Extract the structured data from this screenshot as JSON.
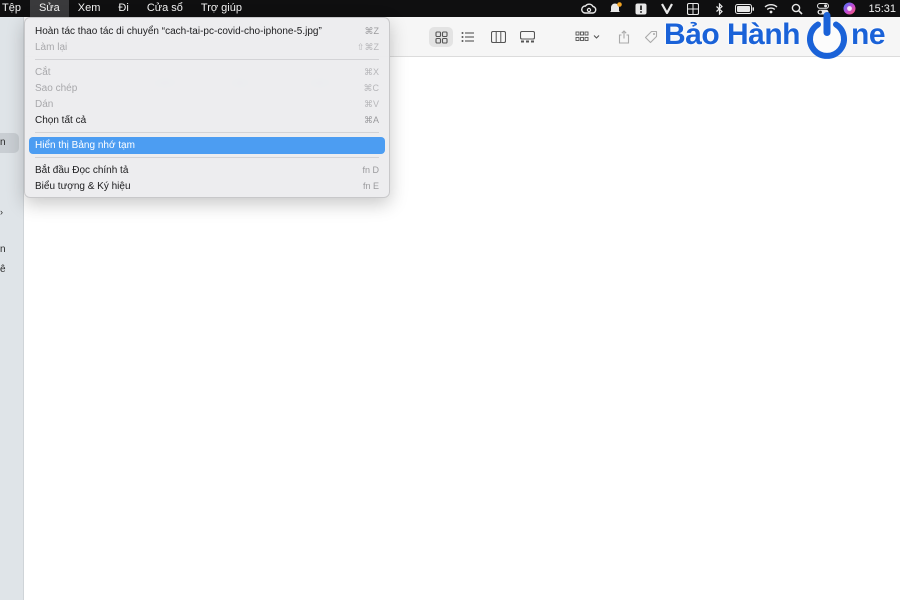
{
  "menubar": {
    "items": [
      "Tệp",
      "Sửa",
      "Xem",
      "Đi",
      "Cửa sổ",
      "Trợ giúp"
    ],
    "active_index": 1,
    "clock": "15:31"
  },
  "sidebar": {
    "fragments": [
      "n",
      "n",
      "ê"
    ]
  },
  "edit_menu": {
    "items": [
      {
        "label": "Hoàn tác thao tác di chuyển “cach-tai-pc-covid-cho-iphone-5.jpg”",
        "shortcut": "⌘Z",
        "enabled": true
      },
      {
        "label": "Làm lại",
        "shortcut": "⇧⌘Z",
        "enabled": false
      },
      {
        "label": "Cắt",
        "shortcut": "⌘X",
        "enabled": false
      },
      {
        "label": "Sao chép",
        "shortcut": "⌘C",
        "enabled": false
      },
      {
        "label": "Dán",
        "shortcut": "⌘V",
        "enabled": false
      },
      {
        "label": "Chọn tất cả",
        "shortcut": "⌘A",
        "enabled": true
      },
      {
        "label": "Hiển thị Bảng nhớ tạm",
        "shortcut": "",
        "enabled": true,
        "highlighted": true
      },
      {
        "label": "Bắt đầu Đọc chính tả",
        "shortcut": "fn D",
        "enabled": true
      },
      {
        "label": "Biểu tượng & Ký hiệu",
        "shortcut": "fn E",
        "enabled": true
      }
    ]
  },
  "logo": {
    "text": "Bảo Hành",
    "text_suffix": "ne",
    "color": "#1a62d8"
  },
  "colors": {
    "menubar_bg": "#0f0f10",
    "highlight": "#4c9df2",
    "sidebar_bg": "#dfe4e8"
  }
}
